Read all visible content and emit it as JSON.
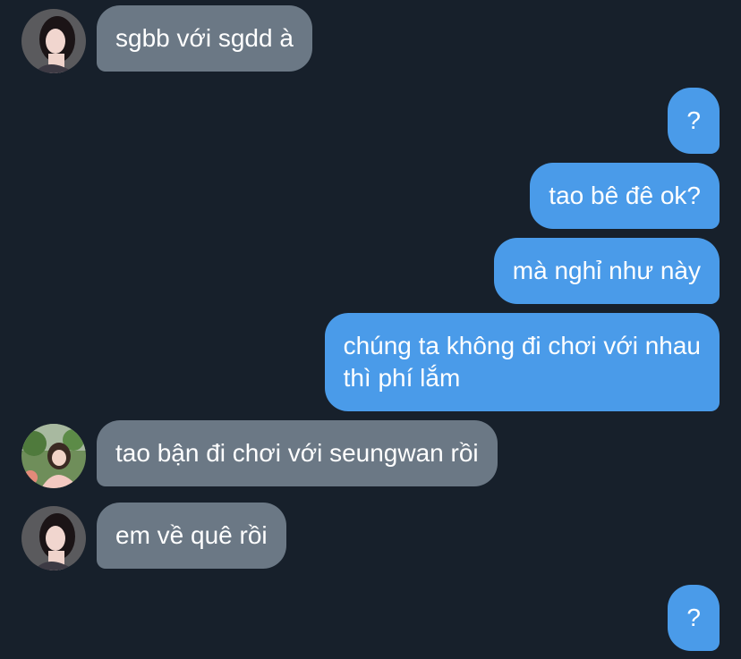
{
  "colors": {
    "background": "#17202b",
    "incoming_bubble": "#6b7885",
    "outgoing_bubble": "#4a9be9",
    "text": "#ffffff"
  },
  "messages": [
    {
      "direction": "incoming",
      "sender_avatar": "avatar-girl-dark",
      "text": "sgbb với sgdd à"
    },
    {
      "direction": "outgoing",
      "text": "?"
    },
    {
      "direction": "outgoing",
      "text": "tao bê đê ok?"
    },
    {
      "direction": "outgoing",
      "text": "mà nghỉ như này"
    },
    {
      "direction": "outgoing",
      "lines": [
        "chúng ta không đi chơi với nhau",
        "thì phí lắm"
      ]
    },
    {
      "direction": "incoming",
      "sender_avatar": "avatar-girl-garden",
      "text": "tao bận đi chơi với seungwan rồi"
    },
    {
      "direction": "incoming",
      "sender_avatar": "avatar-girl-dark",
      "text": "em về quê rồi"
    },
    {
      "direction": "outgoing",
      "text": "?"
    }
  ]
}
